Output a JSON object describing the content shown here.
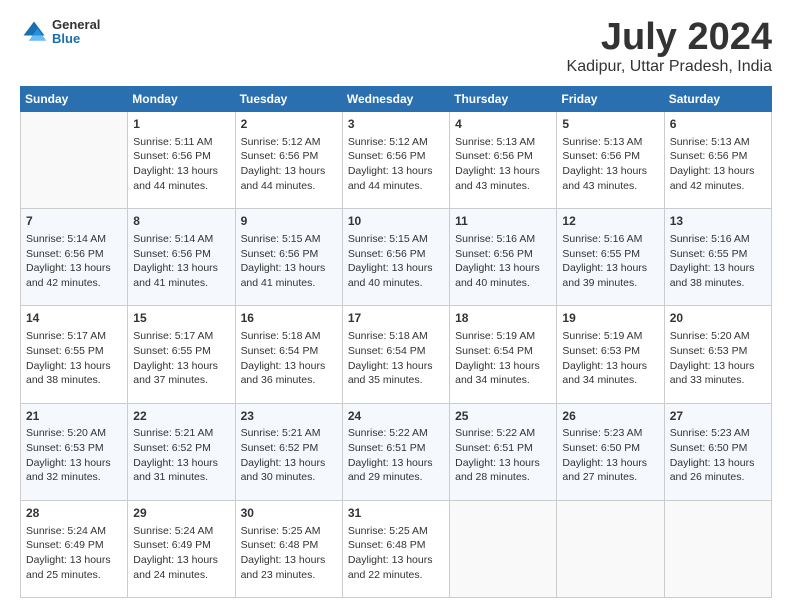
{
  "header": {
    "logo_line1": "General",
    "logo_line2": "Blue",
    "title": "July 2024",
    "subtitle": "Kadipur, Uttar Pradesh, India"
  },
  "calendar": {
    "columns": [
      "Sunday",
      "Monday",
      "Tuesday",
      "Wednesday",
      "Thursday",
      "Friday",
      "Saturday"
    ],
    "weeks": [
      [
        {
          "day": "",
          "empty": true
        },
        {
          "day": "1",
          "sunrise": "Sunrise: 5:11 AM",
          "sunset": "Sunset: 6:56 PM",
          "daylight": "Daylight: 13 hours and 44 minutes."
        },
        {
          "day": "2",
          "sunrise": "Sunrise: 5:12 AM",
          "sunset": "Sunset: 6:56 PM",
          "daylight": "Daylight: 13 hours and 44 minutes."
        },
        {
          "day": "3",
          "sunrise": "Sunrise: 5:12 AM",
          "sunset": "Sunset: 6:56 PM",
          "daylight": "Daylight: 13 hours and 44 minutes."
        },
        {
          "day": "4",
          "sunrise": "Sunrise: 5:13 AM",
          "sunset": "Sunset: 6:56 PM",
          "daylight": "Daylight: 13 hours and 43 minutes."
        },
        {
          "day": "5",
          "sunrise": "Sunrise: 5:13 AM",
          "sunset": "Sunset: 6:56 PM",
          "daylight": "Daylight: 13 hours and 43 minutes."
        },
        {
          "day": "6",
          "sunrise": "Sunrise: 5:13 AM",
          "sunset": "Sunset: 6:56 PM",
          "daylight": "Daylight: 13 hours and 42 minutes."
        }
      ],
      [
        {
          "day": "7",
          "sunrise": "Sunrise: 5:14 AM",
          "sunset": "Sunset: 6:56 PM",
          "daylight": "Daylight: 13 hours and 42 minutes."
        },
        {
          "day": "8",
          "sunrise": "Sunrise: 5:14 AM",
          "sunset": "Sunset: 6:56 PM",
          "daylight": "Daylight: 13 hours and 41 minutes."
        },
        {
          "day": "9",
          "sunrise": "Sunrise: 5:15 AM",
          "sunset": "Sunset: 6:56 PM",
          "daylight": "Daylight: 13 hours and 41 minutes."
        },
        {
          "day": "10",
          "sunrise": "Sunrise: 5:15 AM",
          "sunset": "Sunset: 6:56 PM",
          "daylight": "Daylight: 13 hours and 40 minutes."
        },
        {
          "day": "11",
          "sunrise": "Sunrise: 5:16 AM",
          "sunset": "Sunset: 6:56 PM",
          "daylight": "Daylight: 13 hours and 40 minutes."
        },
        {
          "day": "12",
          "sunrise": "Sunrise: 5:16 AM",
          "sunset": "Sunset: 6:55 PM",
          "daylight": "Daylight: 13 hours and 39 minutes."
        },
        {
          "day": "13",
          "sunrise": "Sunrise: 5:16 AM",
          "sunset": "Sunset: 6:55 PM",
          "daylight": "Daylight: 13 hours and 38 minutes."
        }
      ],
      [
        {
          "day": "14",
          "sunrise": "Sunrise: 5:17 AM",
          "sunset": "Sunset: 6:55 PM",
          "daylight": "Daylight: 13 hours and 38 minutes."
        },
        {
          "day": "15",
          "sunrise": "Sunrise: 5:17 AM",
          "sunset": "Sunset: 6:55 PM",
          "daylight": "Daylight: 13 hours and 37 minutes."
        },
        {
          "day": "16",
          "sunrise": "Sunrise: 5:18 AM",
          "sunset": "Sunset: 6:54 PM",
          "daylight": "Daylight: 13 hours and 36 minutes."
        },
        {
          "day": "17",
          "sunrise": "Sunrise: 5:18 AM",
          "sunset": "Sunset: 6:54 PM",
          "daylight": "Daylight: 13 hours and 35 minutes."
        },
        {
          "day": "18",
          "sunrise": "Sunrise: 5:19 AM",
          "sunset": "Sunset: 6:54 PM",
          "daylight": "Daylight: 13 hours and 34 minutes."
        },
        {
          "day": "19",
          "sunrise": "Sunrise: 5:19 AM",
          "sunset": "Sunset: 6:53 PM",
          "daylight": "Daylight: 13 hours and 34 minutes."
        },
        {
          "day": "20",
          "sunrise": "Sunrise: 5:20 AM",
          "sunset": "Sunset: 6:53 PM",
          "daylight": "Daylight: 13 hours and 33 minutes."
        }
      ],
      [
        {
          "day": "21",
          "sunrise": "Sunrise: 5:20 AM",
          "sunset": "Sunset: 6:53 PM",
          "daylight": "Daylight: 13 hours and 32 minutes."
        },
        {
          "day": "22",
          "sunrise": "Sunrise: 5:21 AM",
          "sunset": "Sunset: 6:52 PM",
          "daylight": "Daylight: 13 hours and 31 minutes."
        },
        {
          "day": "23",
          "sunrise": "Sunrise: 5:21 AM",
          "sunset": "Sunset: 6:52 PM",
          "daylight": "Daylight: 13 hours and 30 minutes."
        },
        {
          "day": "24",
          "sunrise": "Sunrise: 5:22 AM",
          "sunset": "Sunset: 6:51 PM",
          "daylight": "Daylight: 13 hours and 29 minutes."
        },
        {
          "day": "25",
          "sunrise": "Sunrise: 5:22 AM",
          "sunset": "Sunset: 6:51 PM",
          "daylight": "Daylight: 13 hours and 28 minutes."
        },
        {
          "day": "26",
          "sunrise": "Sunrise: 5:23 AM",
          "sunset": "Sunset: 6:50 PM",
          "daylight": "Daylight: 13 hours and 27 minutes."
        },
        {
          "day": "27",
          "sunrise": "Sunrise: 5:23 AM",
          "sunset": "Sunset: 6:50 PM",
          "daylight": "Daylight: 13 hours and 26 minutes."
        }
      ],
      [
        {
          "day": "28",
          "sunrise": "Sunrise: 5:24 AM",
          "sunset": "Sunset: 6:49 PM",
          "daylight": "Daylight: 13 hours and 25 minutes."
        },
        {
          "day": "29",
          "sunrise": "Sunrise: 5:24 AM",
          "sunset": "Sunset: 6:49 PM",
          "daylight": "Daylight: 13 hours and 24 minutes."
        },
        {
          "day": "30",
          "sunrise": "Sunrise: 5:25 AM",
          "sunset": "Sunset: 6:48 PM",
          "daylight": "Daylight: 13 hours and 23 minutes."
        },
        {
          "day": "31",
          "sunrise": "Sunrise: 5:25 AM",
          "sunset": "Sunset: 6:48 PM",
          "daylight": "Daylight: 13 hours and 22 minutes."
        },
        {
          "day": "",
          "empty": true
        },
        {
          "day": "",
          "empty": true
        },
        {
          "day": "",
          "empty": true
        }
      ]
    ]
  }
}
